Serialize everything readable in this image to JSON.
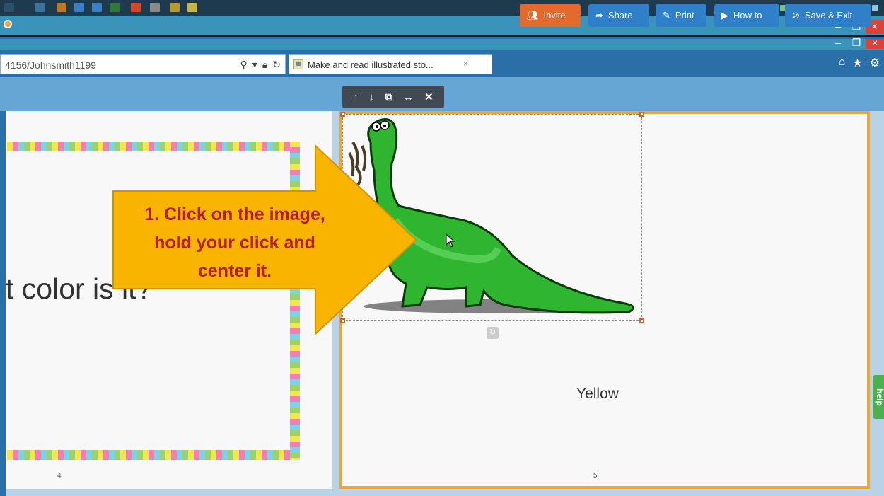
{
  "window": {
    "address": "4156/Johnsmith1199",
    "tab_title": "Make and read illustrated sto...",
    "tab_close": "×",
    "minimize": "–",
    "restore": "❐",
    "close": "×"
  },
  "toolbar": {
    "invite": "Invite",
    "share": "Share",
    "print": "Print",
    "howto": "How to",
    "save": "Save & Exit"
  },
  "pages": {
    "left_text": "t color is it?",
    "left_number": "4",
    "right_text": "Yellow",
    "right_number": "5"
  },
  "callout": {
    "line1": "1. Click on the image,",
    "line2": "hold your click and",
    "line3": "center it."
  },
  "help": "help",
  "colors": {
    "accent_orange": "#e36a2c",
    "button_blue": "#2f7fc9",
    "page_border": "#e9a93a",
    "callout_text": "#b51e1e"
  }
}
